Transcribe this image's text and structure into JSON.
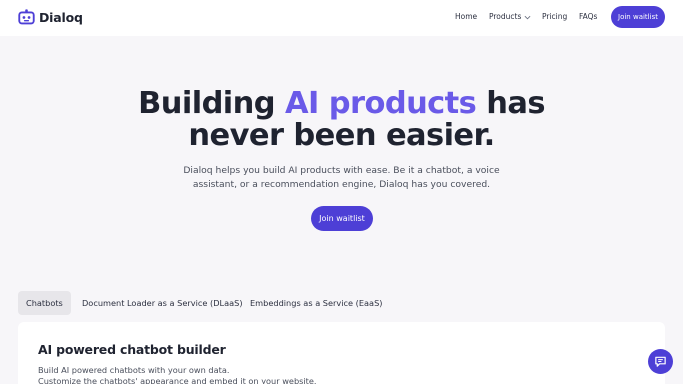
{
  "brand": {
    "name": "Dialoq"
  },
  "nav": {
    "home": "Home",
    "products": "Products",
    "pricing": "Pricing",
    "faqs": "FAQs",
    "cta": "Join waitlist"
  },
  "hero": {
    "title_part1": "Building ",
    "title_accent": "AI products",
    "title_part2": " has",
    "title_line2": "never been easier.",
    "subtitle": "Dialoq helps you build AI products with ease. Be it a chatbot, a voice assistant, or a recommendation engine, Dialoq has you covered.",
    "cta": "Join waitlist"
  },
  "tabs": [
    {
      "label": "Chatbots",
      "active": true
    },
    {
      "label": "Document Loader as a Service (DLaaS)",
      "active": false
    },
    {
      "label": "Embeddings as a Service (EaaS)",
      "active": false
    }
  ],
  "panel": {
    "title": "AI powered chatbot builder",
    "line1": "Build AI powered chatbots with your own data.",
    "line2": "Customize the chatbots' appearance and embed it on your website."
  },
  "colors": {
    "accent": "#4d3fd6",
    "accent_text": "#6a5ae8",
    "background": "#f7f6f9"
  },
  "icons": {
    "logo": "robot-face-icon",
    "chevron": "chevron-down-icon",
    "chat": "chat-bubble-icon"
  }
}
